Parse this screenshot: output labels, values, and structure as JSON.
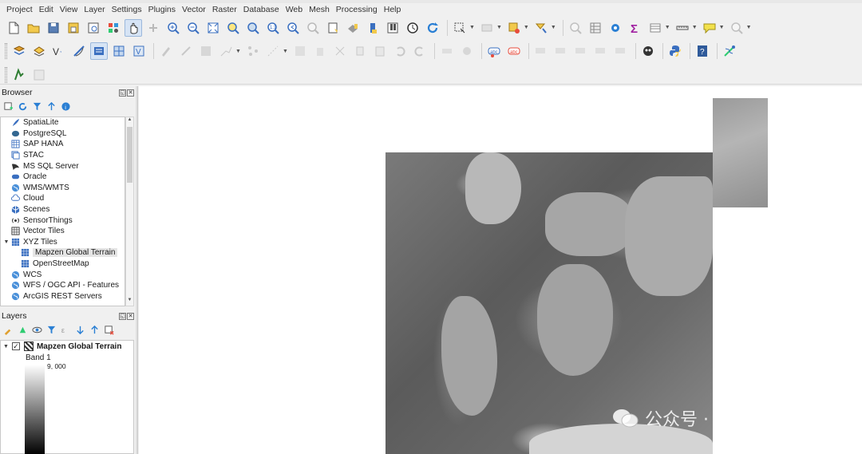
{
  "menubar": {
    "items": [
      "Project",
      "Edit",
      "View",
      "Layer",
      "Settings",
      "Plugins",
      "Vector",
      "Raster",
      "Database",
      "Web",
      "Mesh",
      "Processing",
      "Help"
    ]
  },
  "toolbar_icons": {
    "row1": [
      "new-project-icon",
      "open-project-icon",
      "save-project-icon",
      "save-as-icon",
      "print-layout-icon",
      "style-manager-icon",
      "pan-icon",
      "pan-to-selection-icon",
      "zoom-in-icon",
      "zoom-out-icon",
      "zoom-full-icon",
      "zoom-selection-icon",
      "zoom-layer-icon",
      "zoom-native-icon",
      "zoom-last-icon",
      "zoom-next-icon",
      "new-bookmark-icon",
      "show-bookmarks-icon",
      "new-map-view-icon",
      "new-3d-view-icon",
      "temporal-controller-icon",
      "refresh-icon",
      "select-features-icon",
      "deselect-icon",
      "select-value-icon",
      "identify-icon",
      "attribute-table-icon",
      "processing-toolbox-icon",
      "statistics-icon",
      "measure-icon",
      "annotation-icon",
      "locator-icon"
    ],
    "row2": [
      "add-vector-layer-icon",
      "add-raster-layer-icon",
      "add-delimited-text-icon",
      "add-spatialite-icon",
      "add-postgis-icon",
      "add-mesh-icon",
      "add-virtual-layer-icon",
      "digitize-icon",
      "edit-pencil-icon",
      "save-edits-icon",
      "add-feature-icon",
      "vertex-tool-icon",
      "modify-attributes-icon",
      "delete-selected-icon",
      "cut-features-icon",
      "copy-features-icon",
      "paste-features-icon",
      "undo-icon",
      "redo-icon",
      "label-icon",
      "pin-label-icon",
      "show-labels-icon",
      "rotate-label-icon",
      "change-label-icon",
      "highlight-label-icon",
      "label-toolbar-icon",
      "move-label-icon",
      "diagram-icon",
      "python-console-icon",
      "help-icon",
      "georeferencer-icon"
    ],
    "row3": [
      "coordinate-capture-icon",
      "copy-layout-icon"
    ]
  },
  "browser": {
    "title": "Browser",
    "items": [
      {
        "label": "SpatiaLite",
        "icon": "feather-icon"
      },
      {
        "label": "PostgreSQL",
        "icon": "elephant-icon"
      },
      {
        "label": "SAP HANA",
        "icon": "grid-db-icon"
      },
      {
        "label": "STAC",
        "icon": "stac-icon"
      },
      {
        "label": "MS SQL Server",
        "icon": "mssql-icon"
      },
      {
        "label": "Oracle",
        "icon": "oracle-icon"
      },
      {
        "label": "WMS/WMTS",
        "icon": "globe-icon"
      },
      {
        "label": "Cloud",
        "icon": "cloud-icon"
      },
      {
        "label": "Scenes",
        "icon": "scenes-icon"
      },
      {
        "label": "SensorThings",
        "icon": "sensor-icon"
      },
      {
        "label": "Vector Tiles",
        "icon": "vector-tiles-icon"
      },
      {
        "label": "XYZ Tiles",
        "icon": "xyz-tiles-icon",
        "expanded": true
      },
      {
        "label": "Mapzen Global Terrain",
        "icon": "xyz-tiles-icon",
        "child": true,
        "selected": true
      },
      {
        "label": "OpenStreetMap",
        "icon": "xyz-tiles-icon",
        "child": true
      },
      {
        "label": "WCS",
        "icon": "globe-icon"
      },
      {
        "label": "WFS / OGC API - Features",
        "icon": "globe-icon"
      },
      {
        "label": "ArcGIS REST Servers",
        "icon": "globe-icon"
      }
    ]
  },
  "layers": {
    "title": "Layers",
    "layer_name": "Mapzen Global Terrain",
    "checked": true,
    "band_label": "Band 1",
    "legend_max": "9, 000"
  },
  "watermark": {
    "text": "公众号 · GIS与AI"
  }
}
